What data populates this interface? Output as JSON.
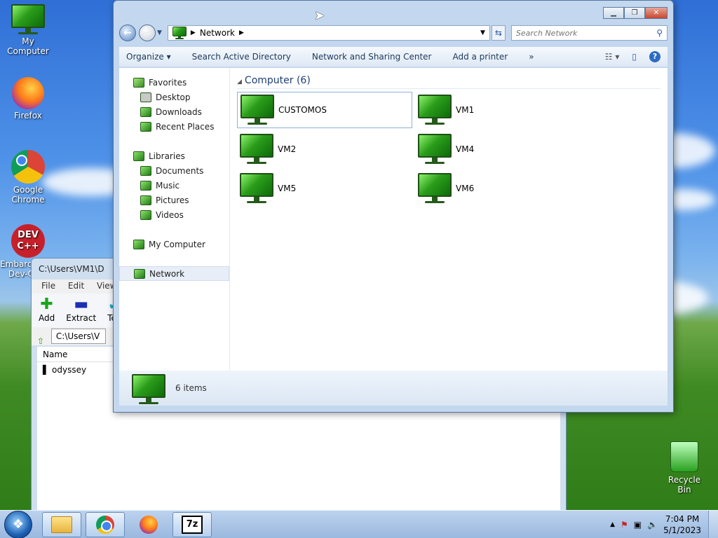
{
  "desktop": {
    "icons": [
      {
        "label": "My Computer"
      },
      {
        "label": "Firefox"
      },
      {
        "label": "Google Chrome"
      },
      {
        "label": "Embarcadero Dev-C++"
      }
    ],
    "recycle_bin": "Recycle Bin"
  },
  "zipwin": {
    "title": "C:\\Users\\VM1\\D",
    "menu": [
      "File",
      "Edit",
      "View"
    ],
    "toolbar": [
      "Add",
      "Extract",
      "Tes"
    ],
    "path": "C:\\Users\\V",
    "column_name": "Name",
    "rows": [
      "odyssey"
    ]
  },
  "explorer": {
    "breadcrumb": "Network",
    "search_placeholder": "Search Network",
    "commands": [
      "Organize",
      "Search Active Directory",
      "Network and Sharing Center",
      "Add a printer"
    ],
    "more": "»",
    "nav": {
      "favorites": "Favorites",
      "fav_items": [
        "Desktop",
        "Downloads",
        "Recent Places"
      ],
      "libraries": "Libraries",
      "lib_items": [
        "Documents",
        "Music",
        "Pictures",
        "Videos"
      ],
      "my_computer": "My Computer",
      "network": "Network"
    },
    "group": "Computer (6)",
    "computers": [
      "CUSTOMOS",
      "VM1",
      "VM2",
      "VM4",
      "VM5",
      "VM6"
    ],
    "status": "6 items"
  },
  "taskbar": {
    "time": "7:04 PM",
    "date": "5/1/2023",
    "sevenz": "7z"
  }
}
